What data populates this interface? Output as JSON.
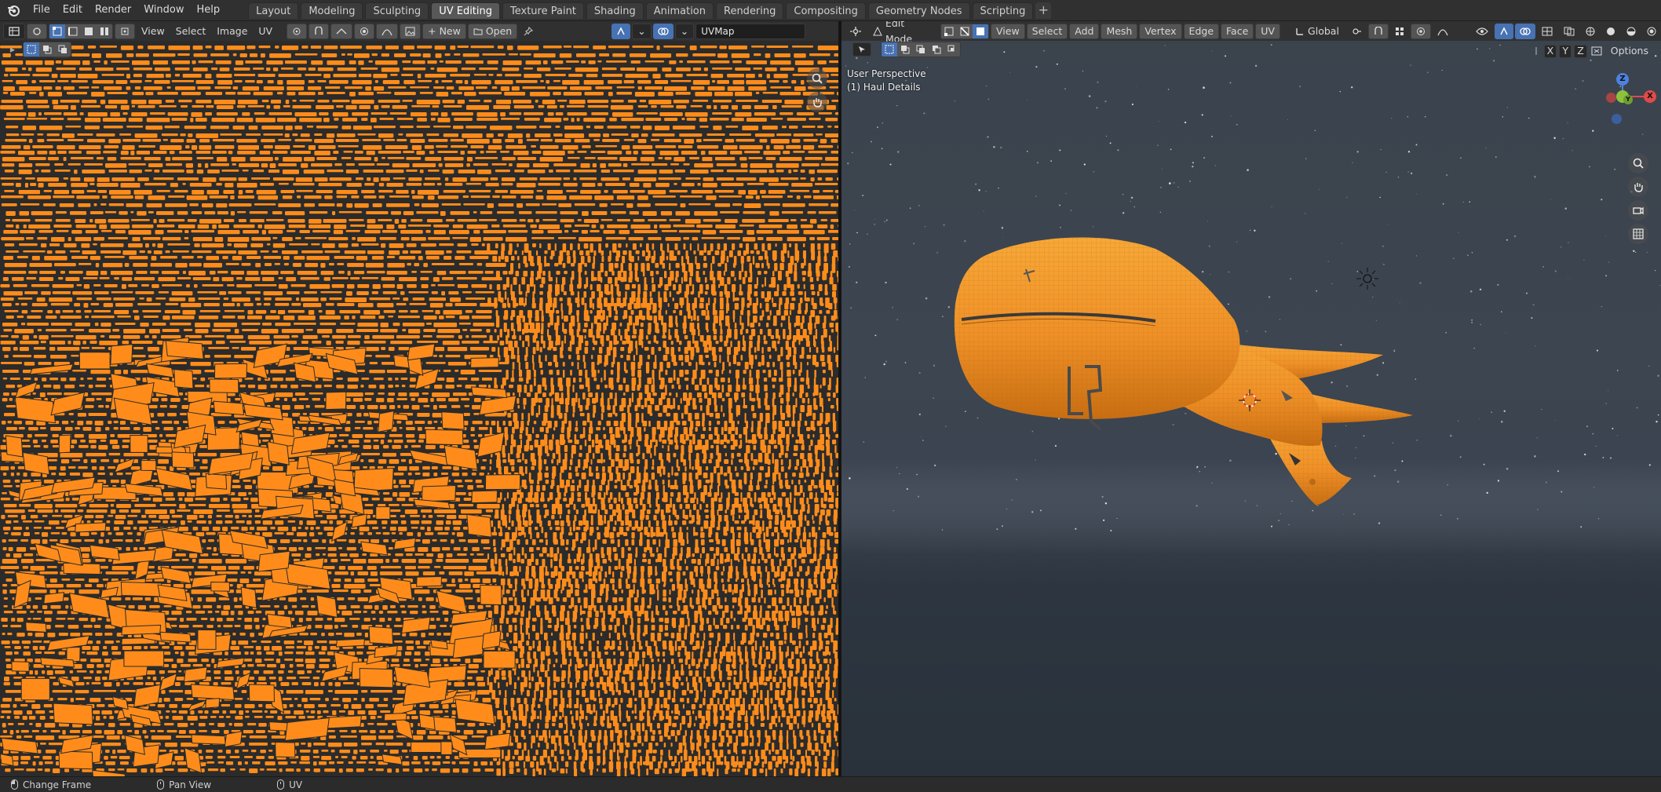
{
  "topbar": {
    "menus": [
      "File",
      "Edit",
      "Render",
      "Window",
      "Help"
    ],
    "workspaces": [
      "Layout",
      "Modeling",
      "Sculpting",
      "UV Editing",
      "Texture Paint",
      "Shading",
      "Animation",
      "Rendering",
      "Compositing",
      "Geometry Nodes",
      "Scripting"
    ],
    "active_workspace": "UV Editing",
    "add_workspace": "+"
  },
  "uv_editor": {
    "menus": [
      "View",
      "Select",
      "Image",
      "UV"
    ],
    "new_label": "New",
    "open_label": "Open",
    "uvmap_value": "UVMap",
    "island_color": "#ff8c1a",
    "background_color": "#2b2b2b"
  },
  "viewport": {
    "mode": "Edit Mode",
    "menus": [
      "View",
      "Select",
      "Add",
      "Mesh",
      "Vertex",
      "Edge",
      "Face",
      "UV"
    ],
    "orientation": "Global",
    "perspective_label": "User Perspective",
    "object_label": "(1) Haul Details",
    "axis_x": "X",
    "axis_y": "Y",
    "axis_z": "Z",
    "options_label": "Options",
    "gizmo": {
      "x": "X",
      "y": "Y",
      "z": "Z"
    },
    "ship_color": "#f39a2c"
  },
  "statusbar": {
    "items": [
      "Change Frame",
      "Pan View",
      "UV"
    ]
  }
}
